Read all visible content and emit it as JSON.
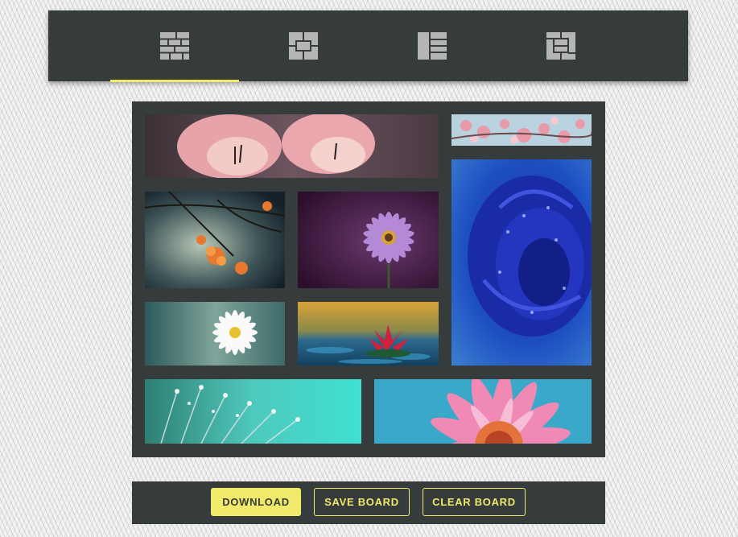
{
  "layout_tabs": [
    {
      "icon": "brick-layout-icon",
      "active": true
    },
    {
      "icon": "cross-layout-icon",
      "active": false
    },
    {
      "icon": "column-layout-icon",
      "active": false
    },
    {
      "icon": "frame-layout-icon",
      "active": false
    }
  ],
  "board": {
    "tiles": [
      {
        "subject": "pink tulips"
      },
      {
        "subject": "cherry blossoms"
      },
      {
        "subject": "orange blossoms on branch"
      },
      {
        "subject": "purple daisy"
      },
      {
        "subject": "blue rose with dew drops"
      },
      {
        "subject": "white daisy"
      },
      {
        "subject": "red water lily"
      },
      {
        "subject": "dandelion seeds with droplets"
      },
      {
        "subject": "pink gerbera"
      }
    ]
  },
  "actions": {
    "download_label": "DOWNLOAD",
    "save_label": "SAVE BOARD",
    "clear_label": "CLEAR BOARD"
  },
  "colors": {
    "panel": "#363b3c",
    "accent": "#f0e96a",
    "icon": "#b5b5b5"
  }
}
